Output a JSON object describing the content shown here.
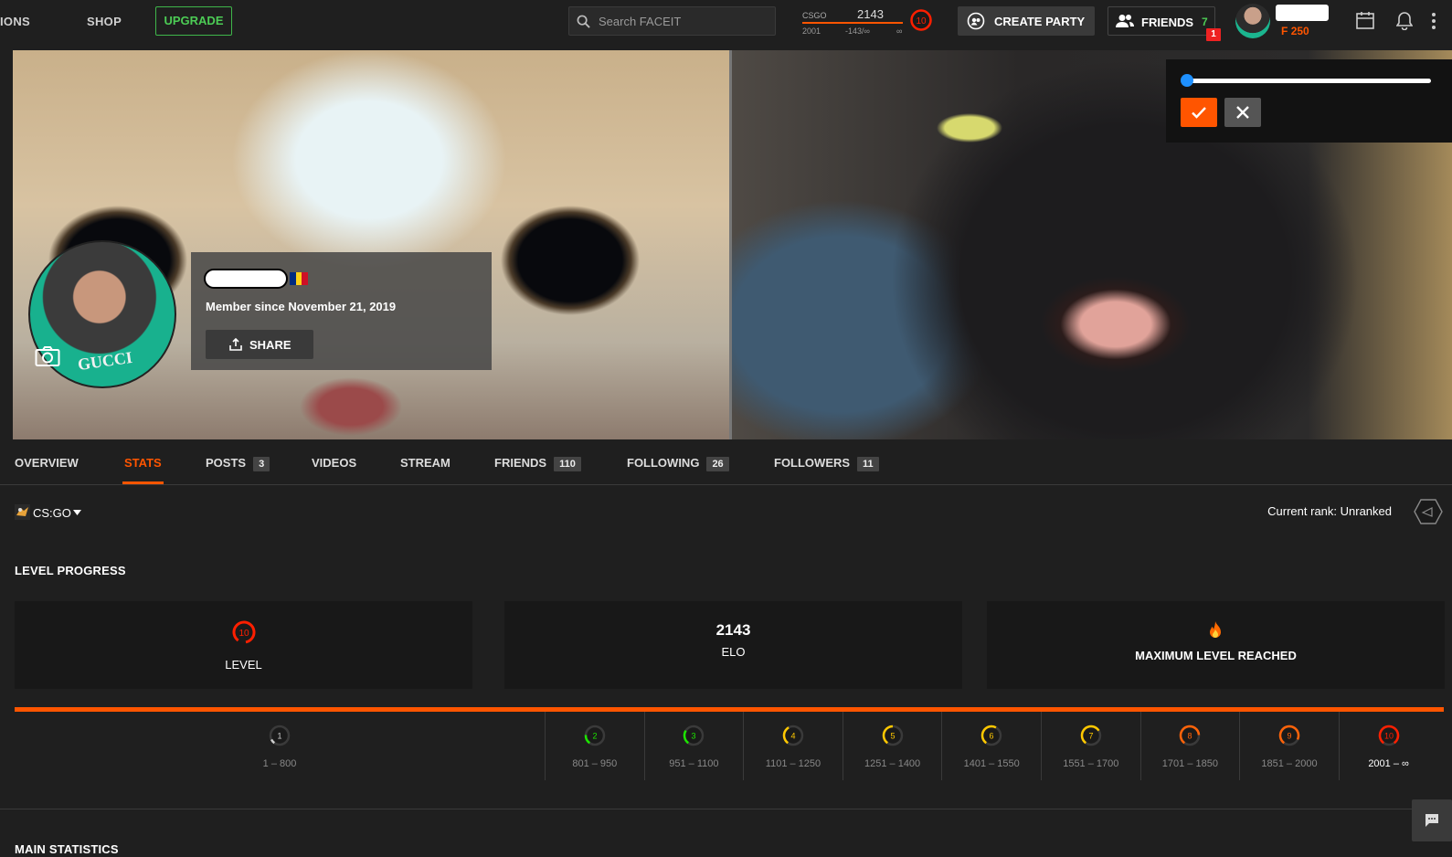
{
  "topbar": {
    "nav_missions": "IONS",
    "nav_shop": "SHOP",
    "upgrade": "UPGRADE",
    "search_placeholder": "Search FACEIT",
    "elo": {
      "game": "CSGO",
      "value": "2143",
      "min": "2001",
      "diff": "-143/∞",
      "max": "∞",
      "level": "10"
    },
    "create_party": "CREATE PARTY",
    "friends_label": "FRIENDS",
    "friends_online": "7",
    "notification_count": "1",
    "points": "250",
    "colors": {
      "accent": "#ff5500",
      "green": "#4ccc55"
    }
  },
  "cover": {
    "slider_value": 0,
    "confirm_icon": "check-icon",
    "cancel_icon": "close-icon"
  },
  "profile": {
    "member_since": "Member since November 21, 2019",
    "share": "SHARE",
    "flag_colors": [
      "#002b7f",
      "#fcd116",
      "#ce1126"
    ]
  },
  "tabs": [
    {
      "label": "OVERVIEW",
      "count": ""
    },
    {
      "label": "STATS",
      "count": ""
    },
    {
      "label": "POSTS",
      "count": "3"
    },
    {
      "label": "VIDEOS",
      "count": ""
    },
    {
      "label": "STREAM",
      "count": ""
    },
    {
      "label": "FRIENDS",
      "count": "110"
    },
    {
      "label": "FOLLOWING",
      "count": "26"
    },
    {
      "label": "FOLLOWERS",
      "count": "11"
    }
  ],
  "active_tab": "STATS",
  "stats": {
    "game": "CS:GO",
    "current_rank": "Current rank: Unranked",
    "level_progress_title": "LEVEL PROGRESS",
    "level_value": "10",
    "level_label": "LEVEL",
    "elo_value": "2143",
    "elo_label": "ELO",
    "max_label": "MAXIMUM LEVEL REACHED",
    "levels": [
      {
        "level": "1",
        "range": "1 – 800",
        "color": "#cccccc"
      },
      {
        "level": "2",
        "range": "801 – 950",
        "color": "#1ce400"
      },
      {
        "level": "3",
        "range": "951 – 1100",
        "color": "#1ce400"
      },
      {
        "level": "4",
        "range": "1101 – 1250",
        "color": "#ffc800"
      },
      {
        "level": "5",
        "range": "1251 – 1400",
        "color": "#ffc800"
      },
      {
        "level": "6",
        "range": "1401 – 1550",
        "color": "#ffc800"
      },
      {
        "level": "7",
        "range": "1551 – 1700",
        "color": "#ffc800"
      },
      {
        "level": "8",
        "range": "1701 – 1850",
        "color": "#ff6309"
      },
      {
        "level": "9",
        "range": "1851 – 2000",
        "color": "#ff6309"
      },
      {
        "level": "10",
        "range": "2001 – ∞",
        "color": "#fe1f00"
      }
    ],
    "main_statistics_title": "MAIN STATISTICS"
  }
}
